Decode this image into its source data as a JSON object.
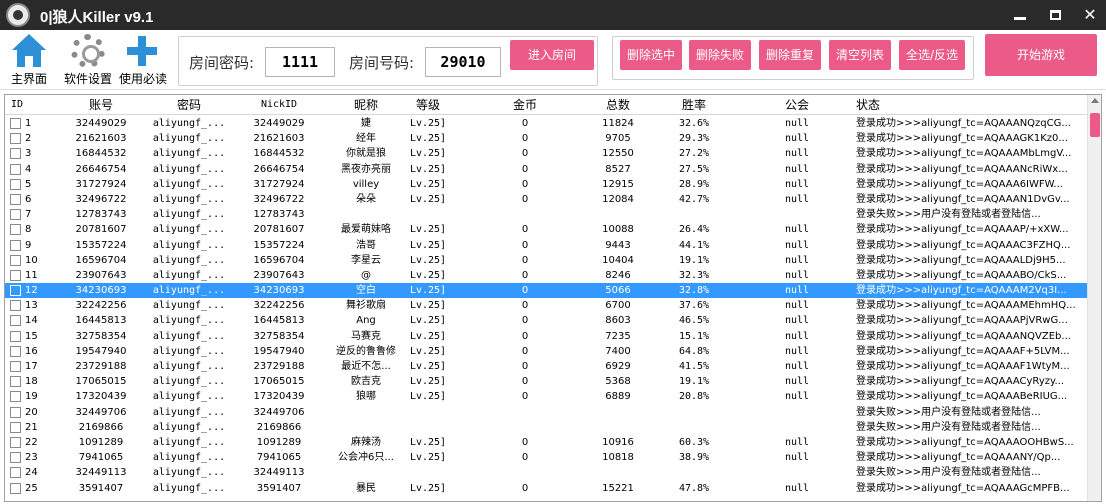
{
  "window": {
    "title": "0|狼人Killer v9.1",
    "minimize": "—",
    "maximize": "□",
    "close": "✕"
  },
  "toolbar": {
    "home_label": "主界面",
    "settings_label": "软件设置",
    "help_label": "使用必读",
    "room_password_label": "房间密码:",
    "room_password_value": "1111",
    "room_number_label": "房间号码:",
    "room_number_value": "29010",
    "enter_room": "进入房间",
    "delete_selected": "删除选中",
    "delete_failed": "删除失败",
    "delete_duplicates": "删除重复",
    "clear_list": "清空列表",
    "select_all_invert": "全选/反选",
    "start_game": "开始游戏"
  },
  "colors": {
    "accent_pink": "#ec5a88",
    "selection_blue": "#3399ff",
    "titlebar": "#2a2a2a",
    "icon_blue": "#2d8fd6"
  },
  "table": {
    "columns": {
      "id": "ID",
      "account": "账号",
      "password": "密码",
      "nickid": "NickID",
      "nickname": "昵称",
      "level": "等级",
      "gold": "金币",
      "total": "总数",
      "winrate": "胜率",
      "guild": "公会",
      "status": "状态"
    },
    "selected_row": 12,
    "rows": [
      {
        "id": "1",
        "account": "32449029",
        "password": "aliyungf_...",
        "nickid": "32449029",
        "nickname": "婕",
        "level": "Lv.25]",
        "gold": "0",
        "total": "11824",
        "winrate": "32.6%",
        "guild": "null",
        "status": "登录成功>>>aliyungf_tc=AQAAANQzqCG..."
      },
      {
        "id": "2",
        "account": "21621603",
        "password": "aliyungf_...",
        "nickid": "21621603",
        "nickname": "经年",
        "level": "Lv.25]",
        "gold": "0",
        "total": "9705",
        "winrate": "29.3%",
        "guild": "null",
        "status": "登录成功>>>aliyungf_tc=AQAAAGK1Kz0..."
      },
      {
        "id": "3",
        "account": "16844532",
        "password": "aliyungf_...",
        "nickid": "16844532",
        "nickname": "你就是狼",
        "level": "Lv.25]",
        "gold": "0",
        "total": "12550",
        "winrate": "27.2%",
        "guild": "null",
        "status": "登录成功>>>aliyungf_tc=AQAAAMbLmgV..."
      },
      {
        "id": "4",
        "account": "26646754",
        "password": "aliyungf_...",
        "nickid": "26646754",
        "nickname": "黑夜亦亮丽",
        "level": "Lv.25]",
        "gold": "0",
        "total": "8527",
        "winrate": "27.5%",
        "guild": "null",
        "status": "登录成功>>>aliyungf_tc=AQAAANcRiWx..."
      },
      {
        "id": "5",
        "account": "31727924",
        "password": "aliyungf_...",
        "nickid": "31727924",
        "nickname": "villey",
        "level": "Lv.25]",
        "gold": "0",
        "total": "12915",
        "winrate": "28.9%",
        "guild": "null",
        "status": "登录成功>>>aliyungf_tc=AQAAA6IWFW..."
      },
      {
        "id": "6",
        "account": "32496722",
        "password": "aliyungf_...",
        "nickid": "32496722",
        "nickname": "朵朵",
        "level": "Lv.25]",
        "gold": "0",
        "total": "12084",
        "winrate": "42.7%",
        "guild": "null",
        "status": "登录成功>>>aliyungf_tc=AQAAAN1DvGv..."
      },
      {
        "id": "7",
        "account": "12783743",
        "password": "aliyungf_...",
        "nickid": "12783743",
        "nickname": "",
        "level": "",
        "gold": "",
        "total": "",
        "winrate": "",
        "guild": "",
        "status": "登录失败>>>用户没有登陆或者登陆信..."
      },
      {
        "id": "8",
        "account": "20781607",
        "password": "aliyungf_...",
        "nickid": "20781607",
        "nickname": "最爱萌妹咯",
        "level": "Lv.25]",
        "gold": "0",
        "total": "10088",
        "winrate": "26.4%",
        "guild": "null",
        "status": "登录成功>>>aliyungf_tc=AQAAAP/+xXW..."
      },
      {
        "id": "9",
        "account": "15357224",
        "password": "aliyungf_...",
        "nickid": "15357224",
        "nickname": "浩哥",
        "level": "Lv.25]",
        "gold": "0",
        "total": "9443",
        "winrate": "44.1%",
        "guild": "null",
        "status": "登录成功>>>aliyungf_tc=AQAAAC3FZHQ..."
      },
      {
        "id": "10",
        "account": "16596704",
        "password": "aliyungf_...",
        "nickid": "16596704",
        "nickname": "李星云",
        "level": "Lv.25]",
        "gold": "0",
        "total": "10404",
        "winrate": "19.1%",
        "guild": "null",
        "status": "登录成功>>>aliyungf_tc=AQAAALDj9H5..."
      },
      {
        "id": "11",
        "account": "23907643",
        "password": "aliyungf_...",
        "nickid": "23907643",
        "nickname": "@",
        "level": "Lv.25]",
        "gold": "0",
        "total": "8246",
        "winrate": "32.3%",
        "guild": "null",
        "status": "登录成功>>>aliyungf_tc=AQAAABO/CkS..."
      },
      {
        "id": "12",
        "account": "34230693",
        "password": "aliyungf_...",
        "nickid": "34230693",
        "nickname": "空白",
        "level": "Lv.25]",
        "gold": "0",
        "total": "5066",
        "winrate": "32.8%",
        "guild": "null",
        "status": "登录成功>>>aliyungf_tc=AQAAAM2Vq3I..."
      },
      {
        "id": "13",
        "account": "32242256",
        "account2": "",
        "password": "aliyungf_...",
        "nickid": "32242256",
        "nickname": "舞衫歌扇",
        "level": "Lv.25]",
        "gold": "0",
        "total": "6700",
        "winrate": "37.6%",
        "guild": "null",
        "status": "登录成功>>>aliyungf_tc=AQAAAMEhmHQ..."
      },
      {
        "id": "14",
        "account": "16445813",
        "password": "aliyungf_...",
        "nickid": "16445813",
        "nickname": "Ang",
        "level": "Lv.25]",
        "gold": "0",
        "total": "8603",
        "winrate": "46.5%",
        "guild": "null",
        "status": "登录成功>>>aliyungf_tc=AQAAAPjVRwG..."
      },
      {
        "id": "15",
        "account": "32758354",
        "password": "aliyungf_...",
        "nickid": "32758354",
        "nickname": "马赛克",
        "level": "Lv.25]",
        "gold": "0",
        "total": "7235",
        "winrate": "15.1%",
        "guild": "null",
        "status": "登录成功>>>aliyungf_tc=AQAAANQVZEb..."
      },
      {
        "id": "16",
        "account": "19547940",
        "password": "aliyungf_...",
        "nickid": "19547940",
        "nickname": "逆反的鲁鲁修",
        "level": "Lv.25]",
        "gold": "0",
        "total": "7400",
        "winrate": "64.8%",
        "guild": "null",
        "status": "登录成功>>>aliyungf_tc=AQAAAF+5LVM..."
      },
      {
        "id": "17",
        "account": "23729188",
        "password": "aliyungf_...",
        "nickid": "23729188",
        "nickname": "最近不怎...",
        "level": "Lv.25]",
        "gold": "0",
        "total": "6929",
        "winrate": "41.5%",
        "guild": "null",
        "status": "登录成功>>>aliyungf_tc=AQAAAF1WtyM..."
      },
      {
        "id": "18",
        "account": "17065015",
        "password": "aliyungf_...",
        "nickid": "17065015",
        "nickname": "欧吉克",
        "level": "Lv.25]",
        "gold": "0",
        "total": "5368",
        "winrate": "19.1%",
        "guild": "null",
        "status": "登录成功>>>aliyungf_tc=AQAAACyRyzy..."
      },
      {
        "id": "19",
        "account": "17320439",
        "password": "aliyungf_...",
        "nickid": "17320439",
        "nickname": "狼哪",
        "level": "Lv.25]",
        "gold": "0",
        "total": "6889",
        "winrate": "20.8%",
        "guild": "null",
        "status": "登录成功>>>aliyungf_tc=AQAAABeRIUG..."
      },
      {
        "id": "20",
        "account": "32449706",
        "password": "aliyungf_...",
        "nickid": "32449706",
        "nickname": "",
        "level": "",
        "gold": "",
        "total": "",
        "winrate": "",
        "guild": "",
        "status": "登录失败>>>用户没有登陆或者登陆信..."
      },
      {
        "id": "21",
        "account": "2169866",
        "password": "aliyungf_...",
        "nickid": "2169866",
        "nickname": "",
        "level": "",
        "gold": "",
        "total": "",
        "winrate": "",
        "guild": "",
        "status": "登录失败>>>用户没有登陆或者登陆信..."
      },
      {
        "id": "22",
        "account": "1091289",
        "password": "aliyungf_...",
        "nickid": "1091289",
        "nickname": "麻辣汤",
        "level": "Lv.25]",
        "gold": "0",
        "total": "10916",
        "winrate": "60.3%",
        "guild": "null",
        "status": "登录成功>>>aliyungf_tc=AQAAAOOHBwS..."
      },
      {
        "id": "23",
        "account": "7941065",
        "password": "aliyungf_...",
        "nickid": "7941065",
        "nickname": "公会冲6只...",
        "level": "Lv.25]",
        "gold": "0",
        "total": "10818",
        "winrate": "38.9%",
        "guild": "null",
        "status": "登录成功>>>aliyungf_tc=AQAAANY/Qp..."
      },
      {
        "id": "24",
        "account": "32449113",
        "password": "aliyungf_...",
        "nickid": "32449113",
        "nickname": "",
        "level": "",
        "gold": "",
        "total": "",
        "winrate": "",
        "guild": "",
        "status": "登录失败>>>用户没有登陆或者登陆信..."
      },
      {
        "id": "25",
        "account": "3591407",
        "password": "aliyungf_...",
        "nickid": "3591407",
        "nickname": "暴民",
        "level": "Lv.25]",
        "gold": "0",
        "total": "15221",
        "winrate": "47.8%",
        "guild": "null",
        "status": "登录成功>>>aliyungf_tc=AQAAAGcMPFB..."
      }
    ]
  }
}
